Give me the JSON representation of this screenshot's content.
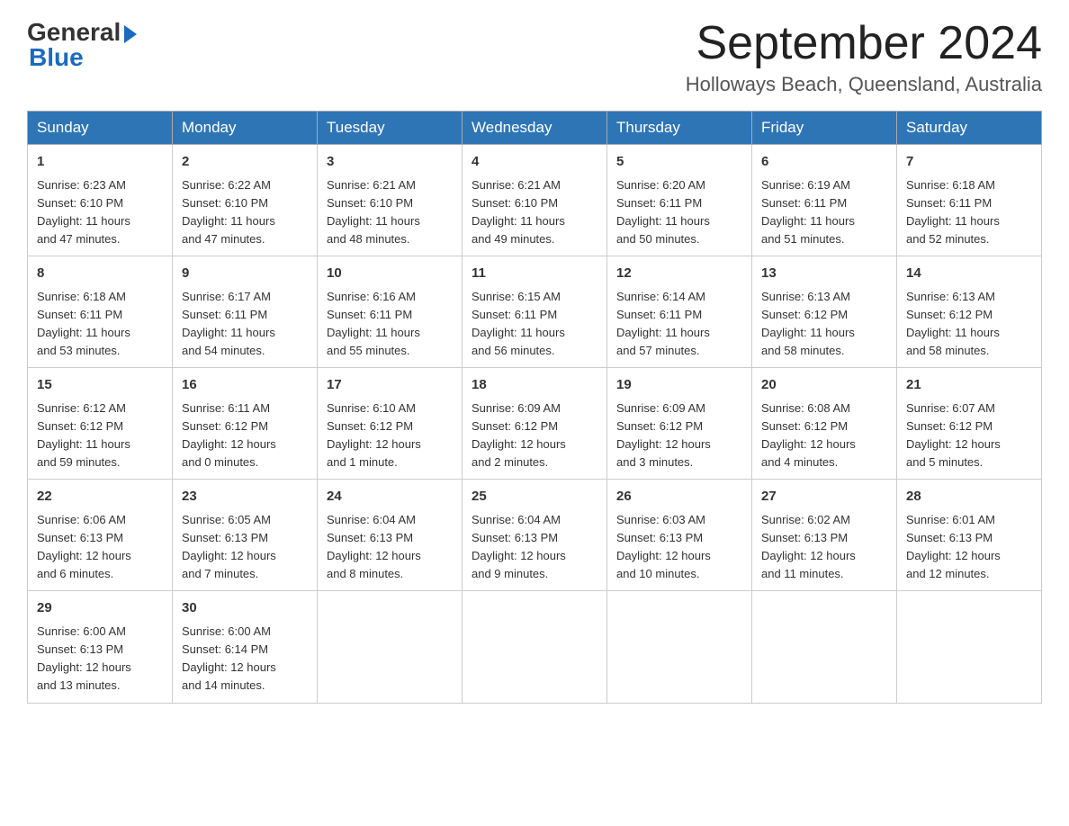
{
  "logo": {
    "general": "General",
    "blue": "Blue"
  },
  "title": {
    "month_year": "September 2024",
    "location": "Holloways Beach, Queensland, Australia"
  },
  "headers": [
    "Sunday",
    "Monday",
    "Tuesday",
    "Wednesday",
    "Thursday",
    "Friday",
    "Saturday"
  ],
  "weeks": [
    [
      {
        "day": "1",
        "sunrise": "6:23 AM",
        "sunset": "6:10 PM",
        "daylight": "11 hours and 47 minutes."
      },
      {
        "day": "2",
        "sunrise": "6:22 AM",
        "sunset": "6:10 PM",
        "daylight": "11 hours and 47 minutes."
      },
      {
        "day": "3",
        "sunrise": "6:21 AM",
        "sunset": "6:10 PM",
        "daylight": "11 hours and 48 minutes."
      },
      {
        "day": "4",
        "sunrise": "6:21 AM",
        "sunset": "6:10 PM",
        "daylight": "11 hours and 49 minutes."
      },
      {
        "day": "5",
        "sunrise": "6:20 AM",
        "sunset": "6:11 PM",
        "daylight": "11 hours and 50 minutes."
      },
      {
        "day": "6",
        "sunrise": "6:19 AM",
        "sunset": "6:11 PM",
        "daylight": "11 hours and 51 minutes."
      },
      {
        "day": "7",
        "sunrise": "6:18 AM",
        "sunset": "6:11 PM",
        "daylight": "11 hours and 52 minutes."
      }
    ],
    [
      {
        "day": "8",
        "sunrise": "6:18 AM",
        "sunset": "6:11 PM",
        "daylight": "11 hours and 53 minutes."
      },
      {
        "day": "9",
        "sunrise": "6:17 AM",
        "sunset": "6:11 PM",
        "daylight": "11 hours and 54 minutes."
      },
      {
        "day": "10",
        "sunrise": "6:16 AM",
        "sunset": "6:11 PM",
        "daylight": "11 hours and 55 minutes."
      },
      {
        "day": "11",
        "sunrise": "6:15 AM",
        "sunset": "6:11 PM",
        "daylight": "11 hours and 56 minutes."
      },
      {
        "day": "12",
        "sunrise": "6:14 AM",
        "sunset": "6:11 PM",
        "daylight": "11 hours and 57 minutes."
      },
      {
        "day": "13",
        "sunrise": "6:13 AM",
        "sunset": "6:12 PM",
        "daylight": "11 hours and 58 minutes."
      },
      {
        "day": "14",
        "sunrise": "6:13 AM",
        "sunset": "6:12 PM",
        "daylight": "11 hours and 58 minutes."
      }
    ],
    [
      {
        "day": "15",
        "sunrise": "6:12 AM",
        "sunset": "6:12 PM",
        "daylight": "11 hours and 59 minutes."
      },
      {
        "day": "16",
        "sunrise": "6:11 AM",
        "sunset": "6:12 PM",
        "daylight": "12 hours and 0 minutes."
      },
      {
        "day": "17",
        "sunrise": "6:10 AM",
        "sunset": "6:12 PM",
        "daylight": "12 hours and 1 minute."
      },
      {
        "day": "18",
        "sunrise": "6:09 AM",
        "sunset": "6:12 PM",
        "daylight": "12 hours and 2 minutes."
      },
      {
        "day": "19",
        "sunrise": "6:09 AM",
        "sunset": "6:12 PM",
        "daylight": "12 hours and 3 minutes."
      },
      {
        "day": "20",
        "sunrise": "6:08 AM",
        "sunset": "6:12 PM",
        "daylight": "12 hours and 4 minutes."
      },
      {
        "day": "21",
        "sunrise": "6:07 AM",
        "sunset": "6:12 PM",
        "daylight": "12 hours and 5 minutes."
      }
    ],
    [
      {
        "day": "22",
        "sunrise": "6:06 AM",
        "sunset": "6:13 PM",
        "daylight": "12 hours and 6 minutes."
      },
      {
        "day": "23",
        "sunrise": "6:05 AM",
        "sunset": "6:13 PM",
        "daylight": "12 hours and 7 minutes."
      },
      {
        "day": "24",
        "sunrise": "6:04 AM",
        "sunset": "6:13 PM",
        "daylight": "12 hours and 8 minutes."
      },
      {
        "day": "25",
        "sunrise": "6:04 AM",
        "sunset": "6:13 PM",
        "daylight": "12 hours and 9 minutes."
      },
      {
        "day": "26",
        "sunrise": "6:03 AM",
        "sunset": "6:13 PM",
        "daylight": "12 hours and 10 minutes."
      },
      {
        "day": "27",
        "sunrise": "6:02 AM",
        "sunset": "6:13 PM",
        "daylight": "12 hours and 11 minutes."
      },
      {
        "day": "28",
        "sunrise": "6:01 AM",
        "sunset": "6:13 PM",
        "daylight": "12 hours and 12 minutes."
      }
    ],
    [
      {
        "day": "29",
        "sunrise": "6:00 AM",
        "sunset": "6:13 PM",
        "daylight": "12 hours and 13 minutes."
      },
      {
        "day": "30",
        "sunrise": "6:00 AM",
        "sunset": "6:14 PM",
        "daylight": "12 hours and 14 minutes."
      },
      null,
      null,
      null,
      null,
      null
    ]
  ]
}
